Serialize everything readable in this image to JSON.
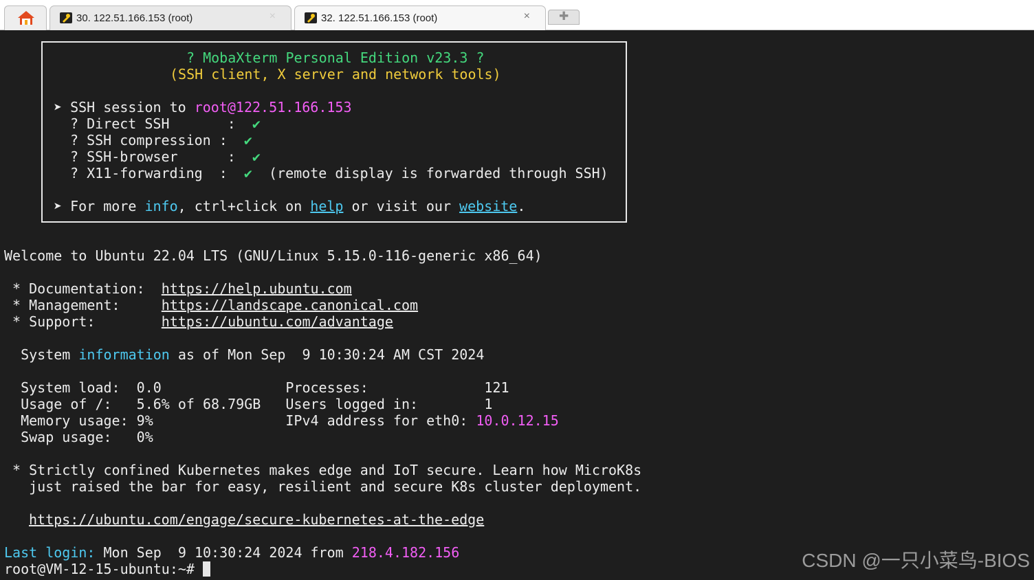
{
  "tabs": [
    {
      "label": "30. 122.51.166.153 (root)",
      "close": "×",
      "active": false
    },
    {
      "label": "32. 122.51.166.153 (root)",
      "close": "×",
      "active": true
    }
  ],
  "banner": {
    "title": "? MobaXterm Personal Edition v23.3 ?",
    "subtitle": "(SSH client, X server and network tools)",
    "session_prefix": "➤ SSH session to ",
    "session_host": "root@122.51.166.153",
    "features": [
      {
        "label": "? Direct SSH       :  ",
        "check": "✔",
        "note": ""
      },
      {
        "label": "? SSH compression :  ",
        "check": "✔",
        "note": ""
      },
      {
        "label": "? SSH-browser      :  ",
        "check": "✔",
        "note": ""
      },
      {
        "label": "? X11-forwarding  :  ",
        "check": "✔",
        "note": "  (remote display is forwarded through SSH)"
      }
    ],
    "more_prefix": "➤ For more ",
    "more_info": "info",
    "more_mid1": ", ctrl+click on ",
    "more_help": "help",
    "more_mid2": " or visit our ",
    "more_website": "website",
    "more_end": "."
  },
  "welcome": "Welcome to Ubuntu 22.04 LTS (GNU/Linux 5.15.0-116-generic x86_64)",
  "links": [
    {
      "label": " * Documentation:  ",
      "url": "https://help.ubuntu.com"
    },
    {
      "label": " * Management:     ",
      "url": "https://landscape.canonical.com"
    },
    {
      "label": " * Support:        ",
      "url": "https://ubuntu.com/advantage"
    }
  ],
  "sysinfo": {
    "prefix": "  System ",
    "highlight": "information",
    "suffix": " as of Mon Sep  9 10:30:24 AM CST 2024"
  },
  "stats": {
    "row1": "  System load:  0.0               Processes:              121",
    "row2": "  Usage of /:   5.6% of 68.79GB   Users logged in:        1",
    "row3_prefix": "  Memory usage: 9%                IPv4 address for eth0: ",
    "row3_ip": "10.0.12.15",
    "row4": "  Swap usage:   0%"
  },
  "notice": {
    "line1": " * Strictly confined Kubernetes makes edge and IoT secure. Learn how MicroK8s",
    "line2": "   just raised the bar for easy, resilient and secure K8s cluster deployment.",
    "url": "https://ubuntu.com/engage/secure-kubernetes-at-the-edge"
  },
  "last_login": {
    "label": "Last login:",
    "middle": " Mon Sep  9 10:30:24 2024 from ",
    "ip": "218.4.182.156"
  },
  "prompt": "root@VM-12-15-ubuntu:~# ",
  "watermark": "CSDN @一只小菜鸟-BIOS",
  "colors": {
    "background": "#1e1e1e",
    "text": "#ececec",
    "green": "#44d87d",
    "yellow": "#f0cc3c",
    "magenta": "#f25ef5",
    "cyan": "#4ec9f0"
  }
}
